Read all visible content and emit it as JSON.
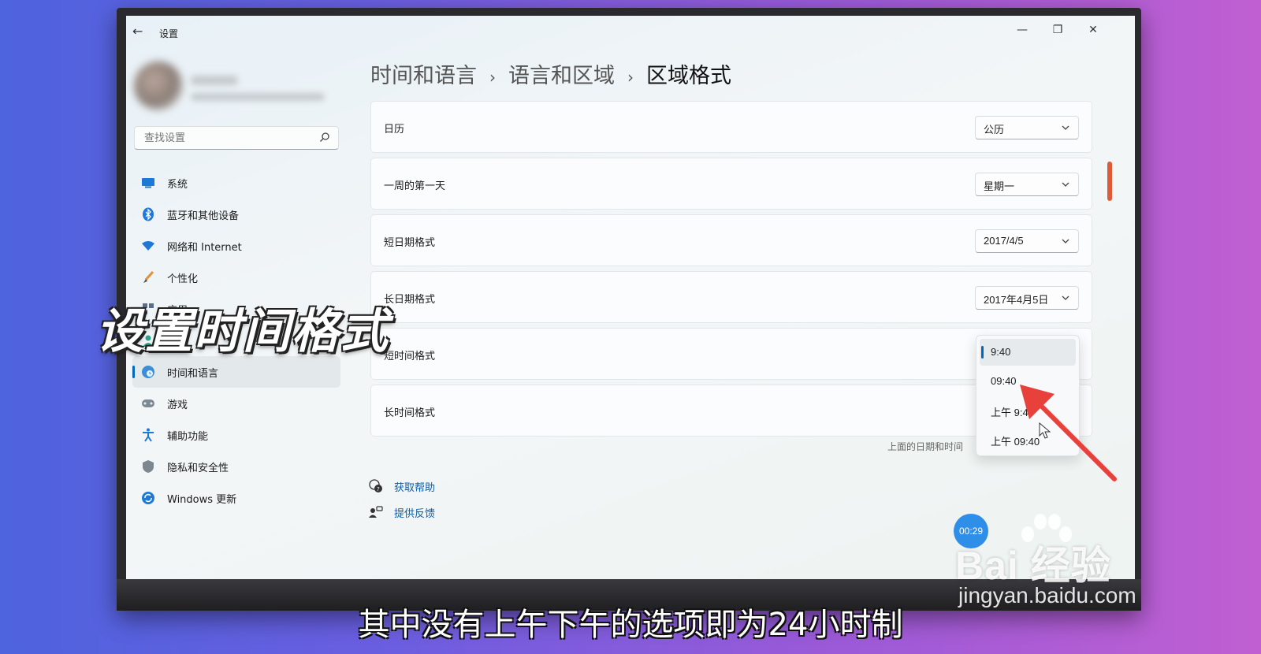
{
  "window": {
    "app_title": "设置",
    "minimize": "—",
    "maximize": "❐",
    "close": "✕"
  },
  "search": {
    "placeholder": "查找设置"
  },
  "sidebar": {
    "items": [
      {
        "label": "系统",
        "icon": "monitor-icon"
      },
      {
        "label": "蓝牙和其他设备",
        "icon": "bluetooth-icon"
      },
      {
        "label": "网络和 Internet",
        "icon": "wifi-icon"
      },
      {
        "label": "个性化",
        "icon": "brush-icon"
      },
      {
        "label": "应用",
        "icon": "apps-icon"
      },
      {
        "label": "帐户",
        "icon": "account-icon"
      },
      {
        "label": "时间和语言",
        "icon": "globe-clock-icon",
        "active": true
      },
      {
        "label": "游戏",
        "icon": "gamepad-icon"
      },
      {
        "label": "辅助功能",
        "icon": "accessibility-icon"
      },
      {
        "label": "隐私和安全性",
        "icon": "shield-icon"
      },
      {
        "label": "Windows 更新",
        "icon": "update-icon"
      }
    ]
  },
  "breadcrumb": {
    "level1": "时间和语言",
    "level2": "语言和区域",
    "current": "区域格式",
    "separator": "›"
  },
  "settings": [
    {
      "label": "日历",
      "value": "公历"
    },
    {
      "label": "一周的第一天",
      "value": "星期一"
    },
    {
      "label": "短日期格式",
      "value": "2017/4/5"
    },
    {
      "label": "长日期格式",
      "value": "2017年4月5日"
    },
    {
      "label": "短时间格式",
      "value": "9:40"
    },
    {
      "label": "长时间格式",
      "value": ""
    }
  ],
  "time_format_menu": {
    "options": [
      "9:40",
      "09:40",
      "上午 9:40",
      "上午 09:40"
    ],
    "selected_index": 0
  },
  "note": "上面的日期和时间",
  "links": {
    "help": "获取帮助",
    "feedback": "提供反馈"
  },
  "timer": "00:29",
  "overlay": {
    "title": "设置时间格式",
    "subtitle": "其中没有上午下午的选项即为24小时制"
  },
  "watermark": {
    "main": "Bai 经验",
    "sub": "jingyan.baidu.com"
  },
  "colors": {
    "accent": "#0067c0",
    "arrow": "#e8403a",
    "link": "#0b5cab"
  }
}
